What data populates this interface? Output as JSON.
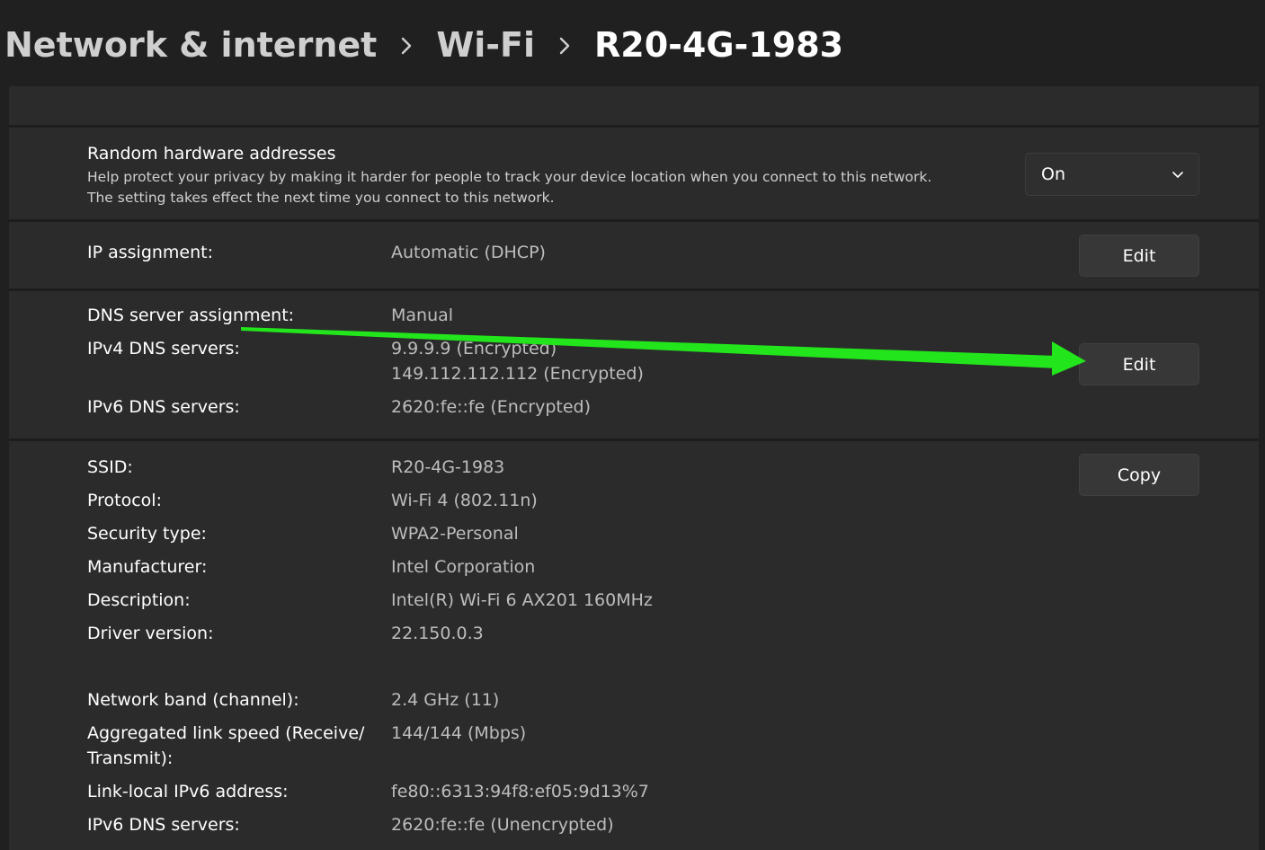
{
  "breadcrumb": {
    "items": [
      "Network & internet",
      "Wi-Fi"
    ],
    "current": "R20-4G-1983"
  },
  "random_hw": {
    "title": "Random hardware addresses",
    "desc_line1": "Help protect your privacy by making it harder for people to track your device location when you connect to this network.",
    "desc_line2": "The setting takes effect the next time you connect to this network.",
    "dropdown_value": "On"
  },
  "ip_assignment": {
    "label": "IP assignment:",
    "value": "Automatic (DHCP)",
    "button": "Edit"
  },
  "dns": {
    "assignment_label": "DNS server assignment:",
    "assignment_value": "Manual",
    "ipv4_label": "IPv4 DNS servers:",
    "ipv4_values": [
      "9.9.9.9 (Encrypted)",
      "149.112.112.112 (Encrypted)"
    ],
    "ipv6_label": "IPv6 DNS servers:",
    "ipv6_value": "2620:fe::fe (Encrypted)",
    "button": "Edit"
  },
  "properties": {
    "copy_button": "Copy",
    "rows": [
      {
        "label": "SSID:",
        "value": "R20-4G-1983"
      },
      {
        "label": "Protocol:",
        "value": "Wi-Fi 4 (802.11n)"
      },
      {
        "label": "Security type:",
        "value": "WPA2-Personal"
      },
      {
        "label": "Manufacturer:",
        "value": "Intel Corporation"
      },
      {
        "label": "Description:",
        "value": "Intel(R) Wi-Fi 6 AX201 160MHz"
      },
      {
        "label": "Driver version:",
        "value": "22.150.0.3"
      },
      {
        "label": "Network band (channel):",
        "value": "2.4 GHz (11)"
      },
      {
        "label_line1": "Aggregated link speed (Receive/",
        "label_line2": "Transmit):",
        "value": "144/144 (Mbps)"
      },
      {
        "label": "Link-local IPv6 address:",
        "value": "fe80::6313:94f8:ef05:9d13%7"
      },
      {
        "label": "IPv6 DNS servers:",
        "value": "2620:fe::fe (Unencrypted)"
      }
    ]
  },
  "colors": {
    "background": "#202020",
    "card": "#2b2b2b",
    "annotation_arrow": "#22e51c"
  },
  "icons": {
    "breadcrumb_separator": "chevron-right-icon",
    "dropdown": "chevron-down-icon"
  }
}
